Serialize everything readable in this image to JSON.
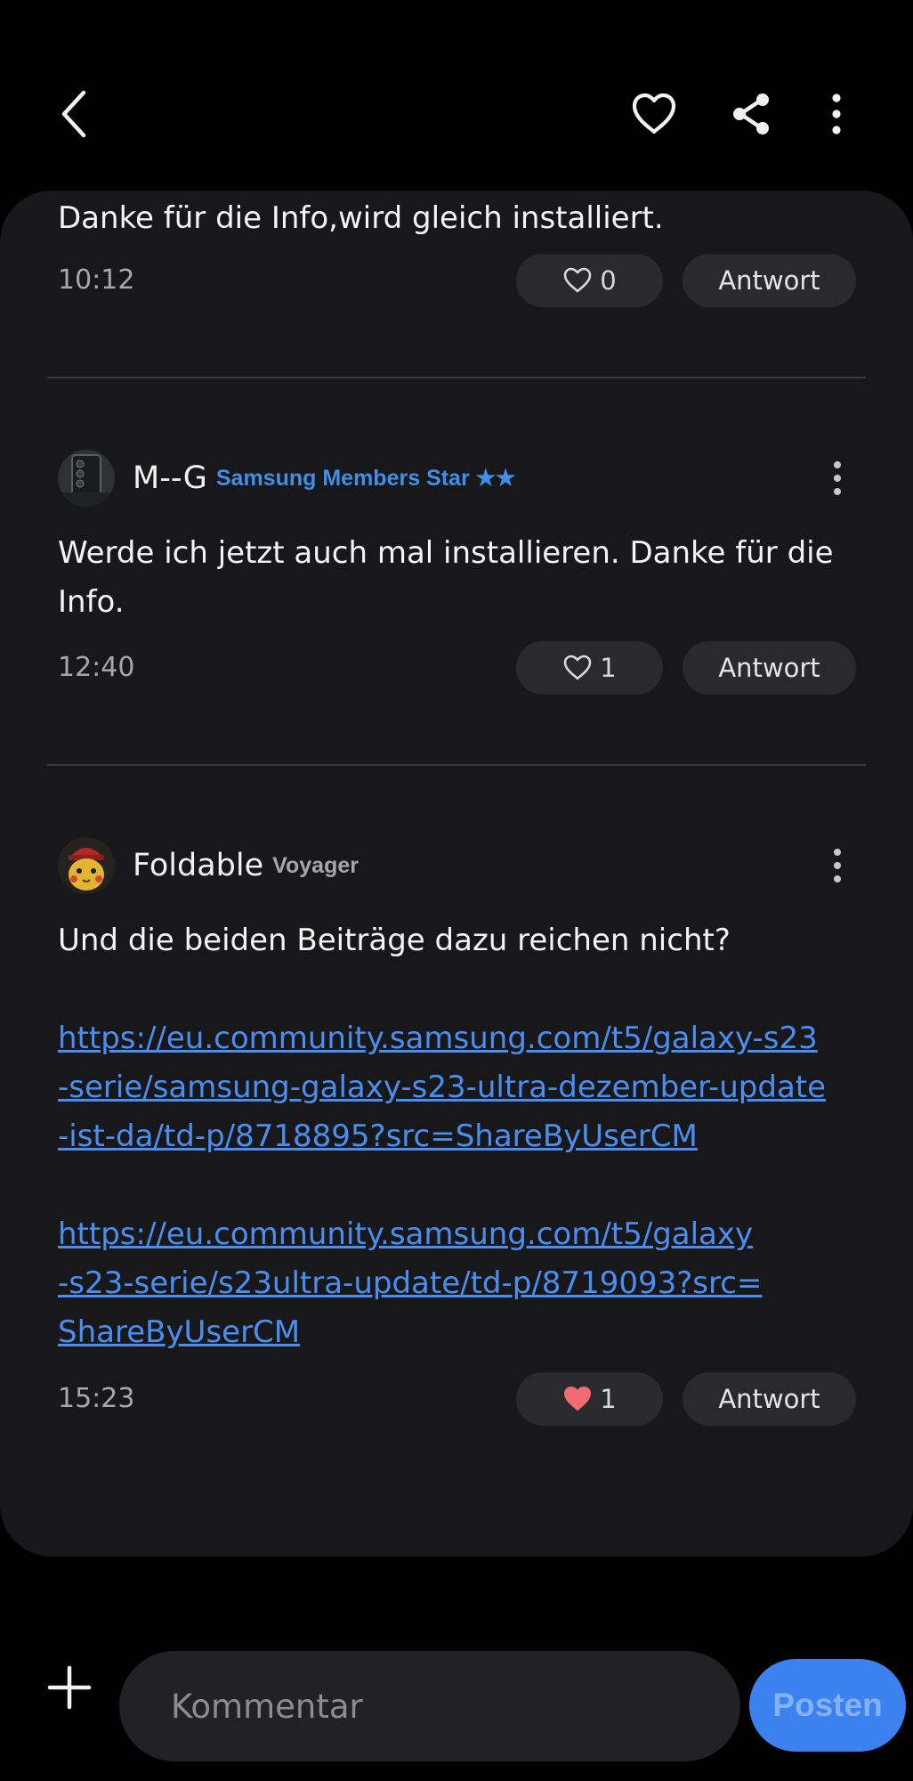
{
  "header": {
    "back_icon": "chevron-left-icon",
    "favorite_icon": "heart-outline-icon",
    "share_icon": "share-icon",
    "more_icon": "more-vertical-icon"
  },
  "comments": [
    {
      "text": "Danke für die Info,wird gleich installiert.",
      "time": "10:12",
      "likes": "0",
      "liked": false,
      "reply_label": "Antwort"
    },
    {
      "author": "M--G",
      "badge": "Samsung Members Star ★★",
      "avatar_icon": "phone-avatar-icon",
      "text": "Werde ich jetzt auch mal installieren. Danke für die\nInfo.",
      "time": "12:40",
      "likes": "1",
      "liked": false,
      "reply_label": "Antwort"
    },
    {
      "author": "Foldable",
      "badge": "Voyager",
      "avatar_icon": "pikachu-avatar-icon",
      "text": "Und die beiden Beiträge dazu reichen nicht?",
      "links": [
        "https://eu.community.samsung.com/t5/galaxy-s23\n-serie/samsung-galaxy-s23-ultra-dezember-update\n-ist-da/td-p/8718895?src=ShareByUserCM",
        "https://eu.community.samsung.com/t5/galaxy\n-s23-serie/s23ultra-update/td-p/8719093?src=\nShareByUserCM"
      ],
      "time": "15:23",
      "likes": "1",
      "liked": true,
      "reply_label": "Antwort"
    }
  ],
  "composer": {
    "placeholder": "Kommentar",
    "post_label": "Posten",
    "add_icon": "plus-icon"
  },
  "colors": {
    "accent": "#3b82f0",
    "link": "#4a8ef0",
    "star_badge": "#3d8fe8",
    "liked_heart": "#f26b73",
    "card_bg": "#18181a"
  }
}
